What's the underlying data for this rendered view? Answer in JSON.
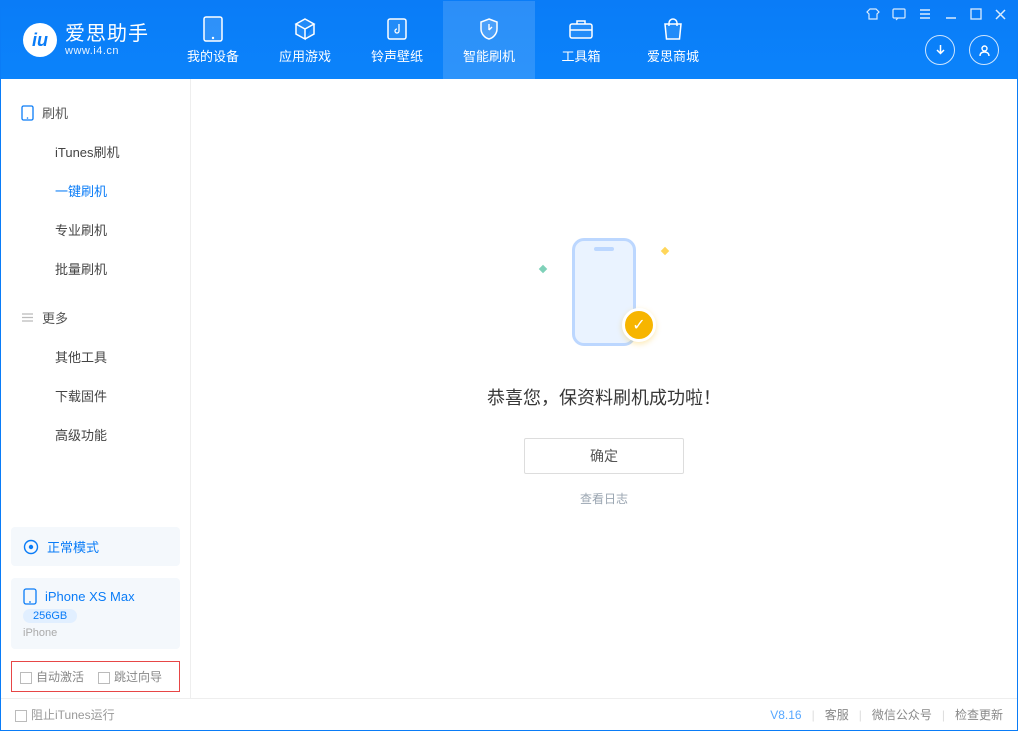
{
  "app": {
    "title": "爱思助手",
    "url": "www.i4.cn"
  },
  "tabs": {
    "device": "我的设备",
    "apps": "应用游戏",
    "ringtone": "铃声壁纸",
    "flash": "智能刷机",
    "toolbox": "工具箱",
    "store": "爱思商城"
  },
  "sidebar": {
    "flash_section": "刷机",
    "items": {
      "itunes": "iTunes刷机",
      "oneclick": "一键刷机",
      "pro": "专业刷机",
      "batch": "批量刷机"
    },
    "more_section": "更多",
    "more": {
      "other": "其他工具",
      "firmware": "下载固件",
      "advanced": "高级功能"
    }
  },
  "device": {
    "mode": "正常模式",
    "name": "iPhone XS Max",
    "storage": "256GB",
    "type": "iPhone"
  },
  "options": {
    "auto_activate": "自动激活",
    "skip_guide": "跳过向导"
  },
  "main": {
    "success": "恭喜您，保资料刷机成功啦！",
    "ok": "确定",
    "viewlog": "查看日志"
  },
  "footer": {
    "block_itunes": "阻止iTunes运行",
    "version": "V8.16",
    "support": "客服",
    "wechat": "微信公众号",
    "update": "检查更新"
  }
}
